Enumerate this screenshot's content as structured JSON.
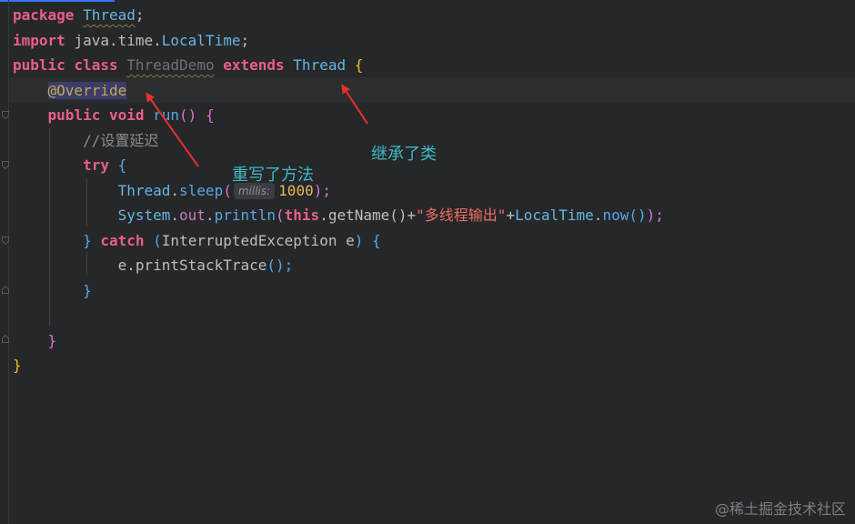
{
  "code": {
    "l1": {
      "kw": "package",
      "pkg": "Thread",
      "semi": ";"
    },
    "l2": {
      "kw": "import",
      "path": "java.time.",
      "cls": "LocalTime",
      "semi": ";"
    },
    "l3": {
      "kw1": "public",
      "kw2": "class",
      "name": "ThreadDemo",
      "kw3": "extends",
      "parent": "Thread",
      "brace": "{"
    },
    "l4": {
      "ann": "@Override"
    },
    "l5": {
      "kw1": "public",
      "kw2": "void",
      "method": "run",
      "parens": "()",
      "brace": "{"
    },
    "l6": {
      "comment": "//设置延迟"
    },
    "l7": {
      "kw": "try",
      "brace": "{"
    },
    "l8": {
      "cls": "Thread",
      "dot": ".",
      "method": "sleep",
      "open": "(",
      "hint": "millis:",
      "num": "1000",
      "close": ");"
    },
    "l9": {
      "cls1": "System",
      "dot1": ".",
      "field": "out",
      "dot2": ".",
      "method": "println",
      "open": "(",
      "kw": "this",
      "dot3": ".",
      "getName": "getName()",
      "plus1": "+",
      "str": "\"多线程输出\"",
      "plus2": "+",
      "cls2": "LocalTime",
      "dot4": ".",
      "now": "now",
      "nowp": "()",
      "close": ");"
    },
    "l10": {
      "close": "}",
      "kw": "catch",
      "open": "(",
      "ex": "InterruptedException",
      "var": "e",
      "close2": ")",
      "brace": "{"
    },
    "l11": {
      "var": "e",
      "dot": ".",
      "method": "printStackTrace",
      "tail": "();"
    },
    "l12": {
      "brace": "}"
    },
    "l14": {
      "brace": "}"
    },
    "l15": {
      "brace": "}"
    }
  },
  "annotations": {
    "override_note": "重写了方法",
    "extends_note": "继承了类",
    "color": "#3fb9c8",
    "arrow_color": "#e8302a"
  },
  "watermark": "@稀土掘金技术社区"
}
